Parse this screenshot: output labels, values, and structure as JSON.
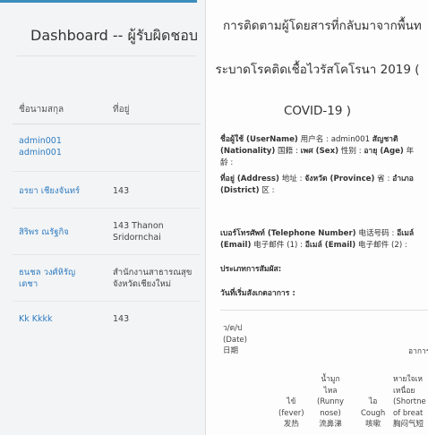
{
  "left_panel": {
    "title": "Dashboard -- ผู้รับผิดชอบ",
    "columns": {
      "name": "ชื่อนามสกุล",
      "address": "ที่อยู่"
    },
    "rows": [
      {
        "name_line1": "admin001",
        "name_line2": "admin001",
        "address_line1": "",
        "address_line2": ""
      },
      {
        "name_line1": "อรยา เชียงจันทร์",
        "name_line2": "",
        "address_line1": "143",
        "address_line2": ""
      },
      {
        "name_line1": "สิริพร ณรัฐกิจ",
        "name_line2": "",
        "address_line1": "143 Thanon",
        "address_line2": "Sridornchai"
      },
      {
        "name_line1": "ธนชล วงศ์หิรัญ",
        "name_line2": "เดชา",
        "address_line1": "สำนักงานสาธารณสุข",
        "address_line2": "จังหวัดเชียงใหม่"
      },
      {
        "name_line1": "Kk Kkkk",
        "name_line2": "",
        "address_line1": "143",
        "address_line2": ""
      }
    ]
  },
  "right_panel": {
    "title_line1": "การติดตามผู้โดยสารที่กลับมาจากพื้นท",
    "title_line2": "ระบาดโรคติดเชื้อไวรัสโคโรนา 2019 (",
    "title_line3": "COVID-19 )",
    "fields": {
      "user_line1_bold": "ชื่อผู้ใช้ (UserName)",
      "user_line1_rest": " 用户名 : admin001 ",
      "user_line1_bold2": "สัญชาติ",
      "user_line2_bold": "(Nationality)",
      "user_line2_rest": " 国籍 : ",
      "user_line2_bold2": "เพศ (Sex)",
      "user_line2_rest2": " 性别 : ",
      "user_line2_bold3": "อายุ (Age)",
      "user_line2_rest3": " 年",
      "user_line3": "龄 :",
      "address_line1_bold": "ที่อยู่ (Address)",
      "address_line1_rest": " 地址 : ",
      "address_line1_bold2": "จังหวัด (Province)",
      "address_line1_rest2": " 省 : ",
      "address_line1_bold3": "อำเภอ",
      "address_line2_bold": "(District)",
      "address_line2_rest": " 区 :",
      "phone_line1_bold": "เบอร์โทรศัพท์ (Telephone Number)",
      "phone_line1_rest": " 电话号码 : ",
      "phone_line1_bold2": "อีเมล์",
      "phone_line2_bold": "(Email)",
      "phone_line2_rest": " 电子邮件 (1) : ",
      "phone_line2_bold2": "อีเมล์ (Email)",
      "phone_line2_rest2": " 电子邮件 (2) :",
      "contact_type": "ประเภทการสัมผัส:",
      "symptom_date": "วันที่เริ่มสังเกตอาการ :"
    },
    "table": {
      "date_col": [
        "ว/ด/ป",
        "(Date)",
        "日期"
      ],
      "symptom_header": "อาการ",
      "fever": [
        "ไข้",
        "(fever)",
        "发热"
      ],
      "runny_nose": [
        "น้ำมูก",
        "ไหล",
        "(Runny",
        "nose)",
        "流鼻涕"
      ],
      "cough": [
        "ไอ",
        "Cough",
        "咳嗽"
      ],
      "short_breath": [
        "หายใจเห",
        "เหนื่อย",
        "(Shortne",
        "of breat",
        "胸闷气短"
      ]
    }
  },
  "colors": {
    "accent": "#3c8dbc",
    "link": "#2f7cc1",
    "panel_bg": "#f3f4f5"
  }
}
